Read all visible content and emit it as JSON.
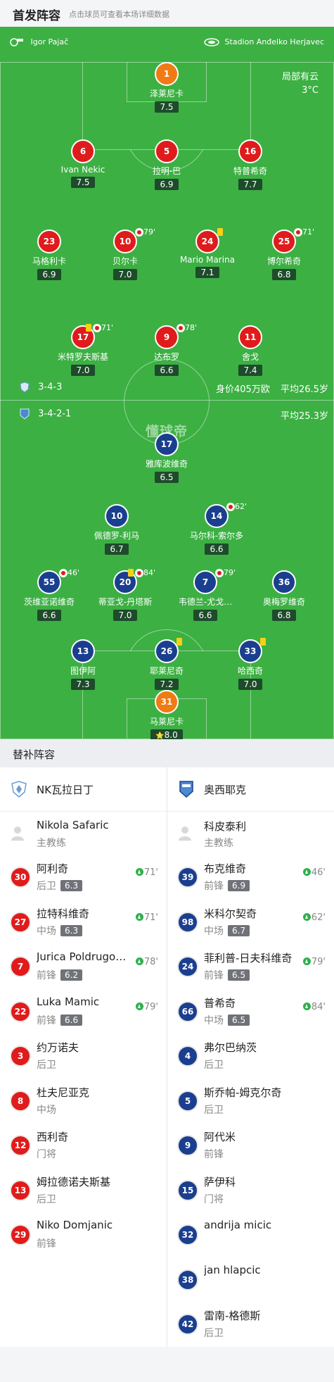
{
  "header": {
    "title": "首发阵容",
    "subtitle": "点击球员可查看本场详细数据"
  },
  "match": {
    "referee": "Igor Pajač",
    "stadium": "Stadion Anđelko Herjavec",
    "weather": "局部有云",
    "temperature": "3°C",
    "watermark": "懂球帝"
  },
  "home_team": {
    "name": "NK瓦拉日丁",
    "formation": "3-4-3",
    "value": "身价405万欧",
    "avg_age": "平均26.5岁",
    "players": [
      {
        "no": "1",
        "name": "泽莱尼卡",
        "rating": "7.5",
        "gk": true
      },
      {
        "no": "6",
        "name": "Ivan Nekic",
        "rating": "7.5"
      },
      {
        "no": "5",
        "name": "拉明-巴",
        "rating": "6.9"
      },
      {
        "no": "16",
        "name": "特普希奇",
        "rating": "7.7"
      },
      {
        "no": "23",
        "name": "马格利卡",
        "rating": "6.9"
      },
      {
        "no": "10",
        "name": "贝尔卡",
        "rating": "7.0",
        "sub_min": "79'"
      },
      {
        "no": "24",
        "name": "Mario Marina",
        "rating": "7.1",
        "yellow": true
      },
      {
        "no": "25",
        "name": "博尔希奇",
        "rating": "6.8",
        "sub_min": "71'"
      },
      {
        "no": "17",
        "name": "米特罗夫斯基",
        "rating": "7.0",
        "yellow": true,
        "sub_min": "71'"
      },
      {
        "no": "9",
        "name": "达布罗",
        "rating": "6.6",
        "sub_min": "78'"
      },
      {
        "no": "11",
        "name": "舍戈",
        "rating": "7.4"
      }
    ]
  },
  "away_team": {
    "name": "奥西耶克",
    "formation": "3-4-2-1",
    "avg_age": "平均25.3岁",
    "players": [
      {
        "no": "17",
        "name": "雅库波维奇",
        "rating": "6.5"
      },
      {
        "no": "10",
        "name": "佩德罗-利马",
        "rating": "6.7"
      },
      {
        "no": "14",
        "name": "马尔科-索尔多",
        "rating": "6.6",
        "sub_min": "62'"
      },
      {
        "no": "55",
        "name": "茨维亚诺维奇",
        "rating": "6.6",
        "sub_min": "46'"
      },
      {
        "no": "20",
        "name": "蒂亚戈-丹塔斯",
        "rating": "7.0",
        "yellow": true,
        "sub_min": "84'"
      },
      {
        "no": "7",
        "name": "韦德兰-尤戈…",
        "rating": "6.6",
        "sub_min": "79'"
      },
      {
        "no": "36",
        "name": "奥梅罗维奇",
        "rating": "6.8"
      },
      {
        "no": "13",
        "name": "图伊阿",
        "rating": "7.3"
      },
      {
        "no": "26",
        "name": "耶莱尼奇",
        "rating": "7.2",
        "yellow": true
      },
      {
        "no": "33",
        "name": "哈西奇",
        "rating": "7.0",
        "yellow": true
      },
      {
        "no": "31",
        "name": "马莱尼卡",
        "rating": "8.0",
        "gk": true,
        "star": true
      }
    ]
  },
  "subs": {
    "title": "替补阵容",
    "home": {
      "team": "NK瓦拉日丁",
      "coach": {
        "name": "Nikola Safaric",
        "role": "主教练"
      },
      "list": [
        {
          "no": "30",
          "name": "阿利奇",
          "pos": "后卫",
          "rating": "6.3",
          "min": "71'"
        },
        {
          "no": "27",
          "name": "拉特科维奇",
          "pos": "中场",
          "rating": "6.3",
          "min": "71'"
        },
        {
          "no": "7",
          "name": "Jurica Poldrugovac",
          "pos": "前锋",
          "rating": "6.2",
          "min": "78'"
        },
        {
          "no": "22",
          "name": "Luka Mamic",
          "pos": "前锋",
          "rating": "6.6",
          "min": "79'"
        },
        {
          "no": "3",
          "name": "约万诺夫",
          "pos": "后卫"
        },
        {
          "no": "8",
          "name": "杜夫尼亚克",
          "pos": "中场"
        },
        {
          "no": "12",
          "name": "西利奇",
          "pos": "门将"
        },
        {
          "no": "13",
          "name": "姆拉德诺夫斯基",
          "pos": "后卫"
        },
        {
          "no": "29",
          "name": "Niko Domjanic",
          "pos": "前锋"
        }
      ]
    },
    "away": {
      "team": "奥西耶克",
      "coach": {
        "name": "科皮泰利",
        "role": "主教练"
      },
      "list": [
        {
          "no": "39",
          "name": "布克维奇",
          "pos": "前锋",
          "rating": "6.9",
          "min": "46'"
        },
        {
          "no": "98",
          "name": "米科尔契奇",
          "pos": "中场",
          "rating": "6.7",
          "min": "62'"
        },
        {
          "no": "24",
          "name": "菲利普-日夫科维奇",
          "pos": "前锋",
          "rating": "6.5",
          "min": "79'"
        },
        {
          "no": "66",
          "name": "普希奇",
          "pos": "中场",
          "rating": "6.5",
          "min": "84'"
        },
        {
          "no": "4",
          "name": "弗尔巴纳茨",
          "pos": "后卫"
        },
        {
          "no": "5",
          "name": "斯乔帕-姆克尔奇",
          "pos": "后卫"
        },
        {
          "no": "9",
          "name": "阿代米",
          "pos": "前锋"
        },
        {
          "no": "15",
          "name": "萨伊科",
          "pos": "门将"
        },
        {
          "no": "32",
          "name": "andrija micic",
          "pos": ""
        },
        {
          "no": "38",
          "name": "jan hlapcic",
          "pos": ""
        },
        {
          "no": "42",
          "name": "雷南-格德斯",
          "pos": "后卫"
        }
      ]
    }
  }
}
